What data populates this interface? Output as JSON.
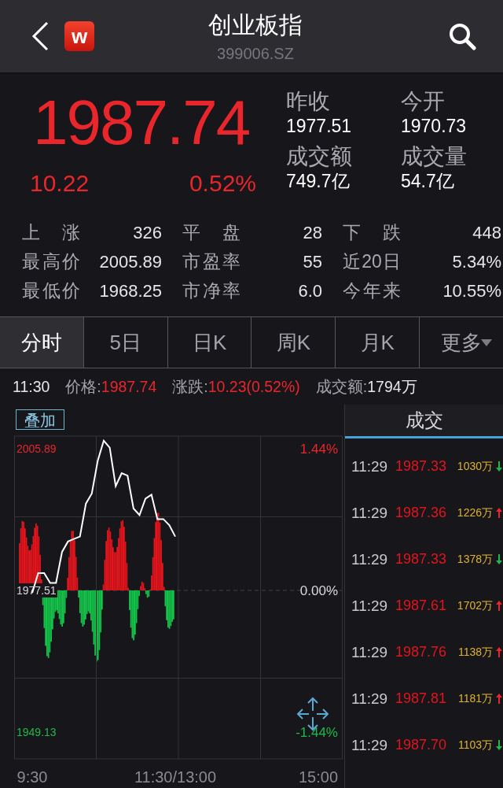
{
  "header": {
    "logo": "w",
    "title": "创业板指",
    "code": "399006.SZ"
  },
  "quote": {
    "price": "1987.74",
    "change": "10.22",
    "change_pct": "0.52%",
    "rising": true,
    "fields": [
      {
        "label": "昨收",
        "value": "1977.51"
      },
      {
        "label": "今开",
        "value": "1970.73"
      },
      {
        "label": "成交额",
        "value": "749.7亿"
      },
      {
        "label": "成交量",
        "value": "54.7亿"
      }
    ],
    "stats": [
      {
        "label": "上 涨",
        "value": "326"
      },
      {
        "label": "平 盘",
        "value": "28"
      },
      {
        "label": "下 跌",
        "value": "448"
      },
      {
        "label": "最高价",
        "value": "2005.89"
      },
      {
        "label": "市盈率",
        "value": "55"
      },
      {
        "label": "近20日",
        "value": "5.34%"
      },
      {
        "label": "最低价",
        "value": "1968.25"
      },
      {
        "label": "市净率",
        "value": "6.0"
      },
      {
        "label": "今年来",
        "value": "10.55%"
      }
    ]
  },
  "tabs": [
    {
      "label": "分时",
      "kind": "period",
      "selected": true
    },
    {
      "label": "5日",
      "kind": "period",
      "selected": false
    },
    {
      "label": "日K",
      "kind": "period",
      "selected": false
    },
    {
      "label": "周K",
      "kind": "period",
      "selected": false
    },
    {
      "label": "月K",
      "kind": "period",
      "selected": false
    },
    {
      "label": "更多",
      "kind": "menu",
      "selected": false
    }
  ],
  "info": {
    "time": "11:30",
    "items": [
      {
        "label": "价格:",
        "value": "1987.74",
        "color": "#e8262b"
      },
      {
        "label": "涨跌:",
        "value": "10.23(0.52%)",
        "color": "#e8262b"
      },
      {
        "label": "成交额:",
        "value": "1794万",
        "color": "#e6e6ea"
      }
    ]
  },
  "chart": {
    "overlay_button": "叠加",
    "right_labels": [
      {
        "label": "1.44%",
        "color": "#e8262b"
      },
      {
        "label": "0.00%",
        "color": "#d8d8dc"
      },
      {
        "label": "-1.44%",
        "color": "#1fb84a"
      }
    ],
    "chart_data": {
      "type": "line",
      "categories": [
        "9:30",
        null,
        null,
        null,
        null,
        null,
        null,
        null,
        null,
        null,
        null,
        null,
        null,
        null,
        null,
        null,
        null,
        null,
        null,
        null,
        null,
        null,
        null,
        null,
        "11:30/13:00",
        null,
        null,
        null,
        null,
        null,
        null,
        null,
        null,
        null,
        null,
        null,
        null,
        null,
        null,
        null,
        null,
        null,
        null,
        null,
        null,
        null,
        null,
        null,
        "15:00"
      ],
      "series": [
        {
          "color": "#ffffff",
          "values": [
            1977.0,
            1981.0,
            1981.0,
            1979.0,
            1979.0,
            1985.2,
            1987.3,
            1987.8,
            1988.3,
            1994.9,
            1996.9,
            2003.5,
            2007.5,
            2006.1,
            1998.4,
            2001.0,
            2000.5,
            1993.9,
            1992.6,
            1995.9,
            1996.7,
            1991.8,
            1991.8,
            1990.6,
            1988.3,
            null,
            null,
            null,
            null,
            null,
            null,
            null,
            null,
            null,
            null,
            null,
            null,
            null,
            null,
            null,
            null,
            null,
            null,
            null,
            null,
            null,
            null,
            null,
            null
          ]
        }
      ],
      "ylim": [
        1943.77,
        2008.41
      ],
      "yticks": [
        {
          "value": 2005.89,
          "label": "2005.89"
        },
        {
          "value": 1977.51,
          "label": "1977.51"
        },
        {
          "value": 1949.13,
          "label": "1949.13"
        }
      ]
    }
  },
  "trades": {
    "title": "成交",
    "rows": [
      {
        "time": "11:29",
        "price": "1987.33",
        "volume": "1030万",
        "up": false
      },
      {
        "time": "11:29",
        "price": "1987.36",
        "volume": "1226万",
        "up": true
      },
      {
        "time": "11:29",
        "price": "1987.33",
        "volume": "1378万",
        "up": false
      },
      {
        "time": "11:29",
        "price": "1987.61",
        "volume": "1702万",
        "up": true
      },
      {
        "time": "11:29",
        "price": "1987.76",
        "volume": "1138万",
        "up": true
      },
      {
        "time": "11:29",
        "price": "1987.81",
        "volume": "1181万",
        "up": true
      },
      {
        "time": "11:29",
        "price": "1987.70",
        "volume": "1103万",
        "up": false
      }
    ]
  }
}
